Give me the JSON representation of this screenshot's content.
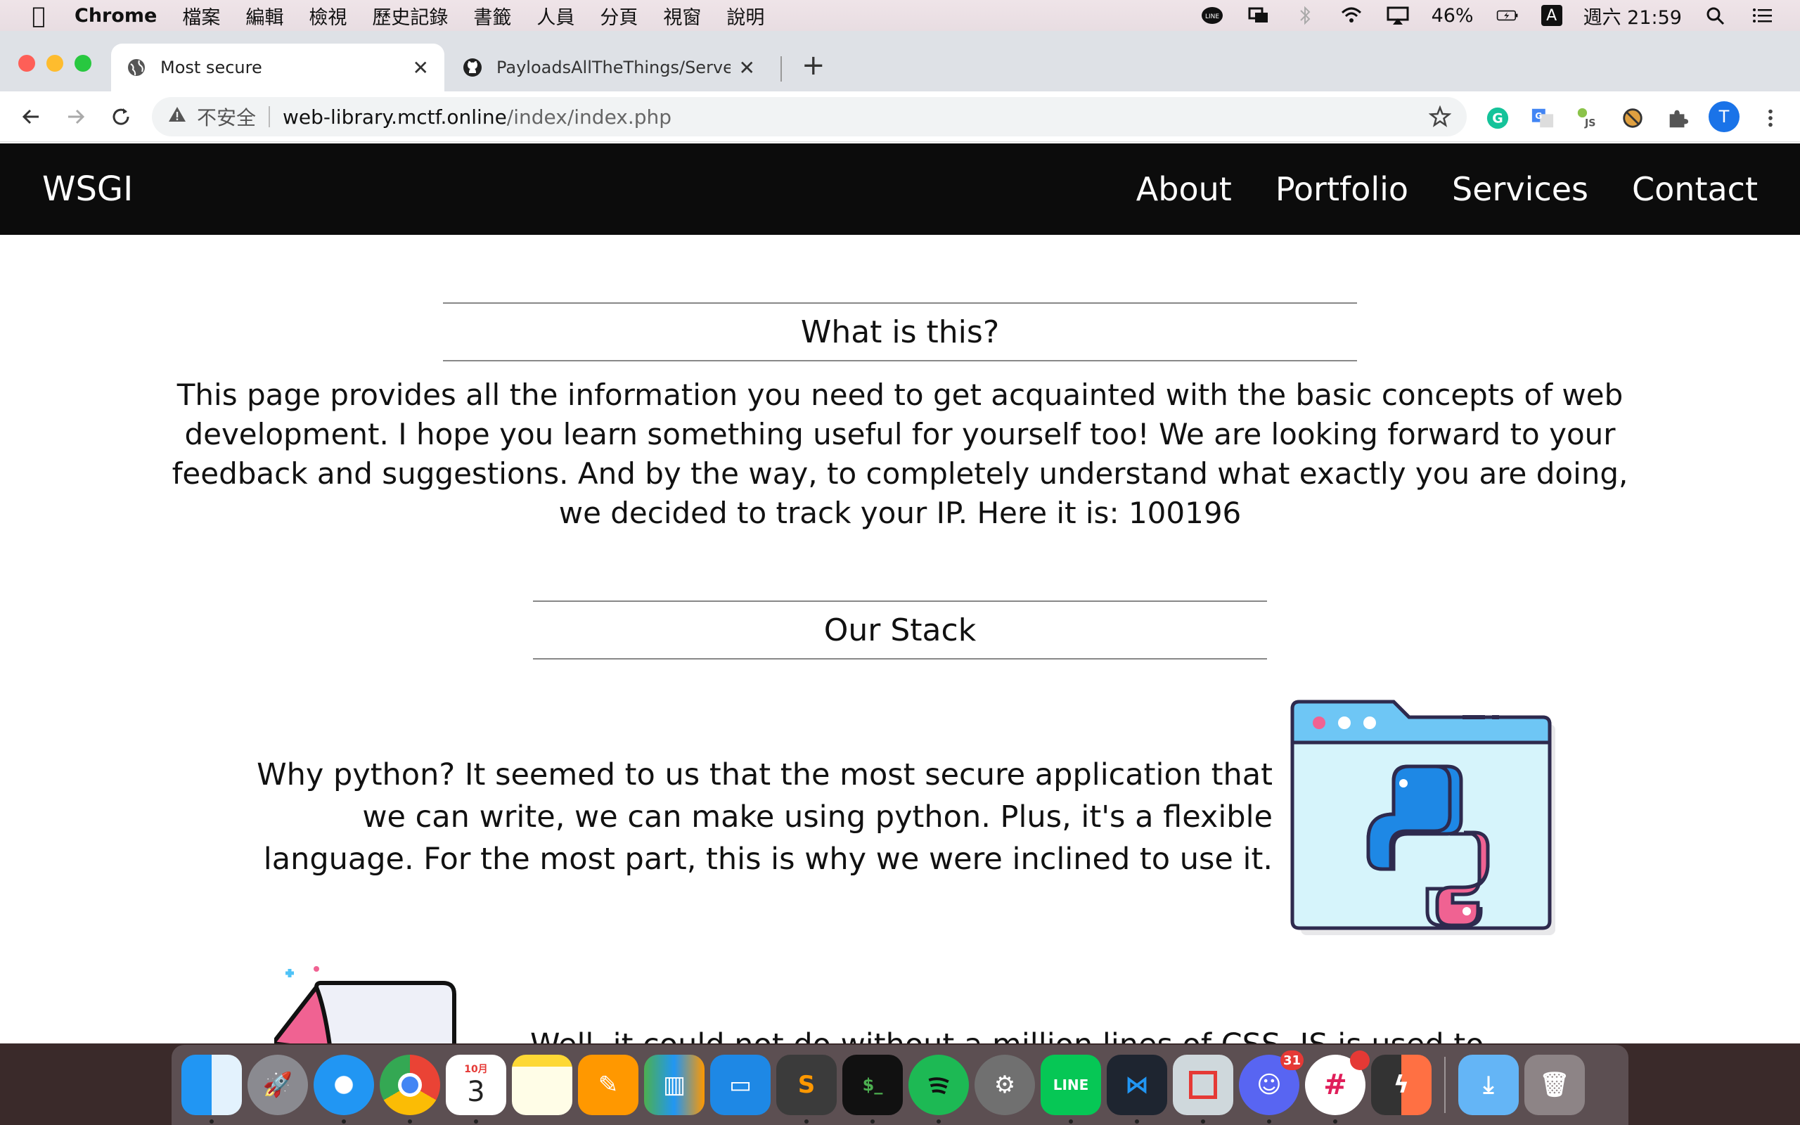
{
  "menubar": {
    "app_name": "Chrome",
    "menus": [
      "檔案",
      "編輯",
      "檢視",
      "歷史記錄",
      "書籤",
      "人員",
      "分頁",
      "視窗",
      "說明"
    ],
    "battery": "46%",
    "input_method": "A",
    "clock": "週六 21:59"
  },
  "browser": {
    "tabs": [
      {
        "title": "Most secure",
        "icon": "globe-icon"
      },
      {
        "title": "PayloadsAllTheThings/Server S",
        "icon": "github-icon"
      }
    ],
    "security_label": "不安全",
    "url_host": "web-library.mctf.online",
    "url_path": "/index/index.php",
    "profile_initial": "T"
  },
  "site": {
    "brand": "WSGI",
    "nav": [
      "About",
      "Portfolio",
      "Services",
      "Contact"
    ],
    "section1_title": "What is this?",
    "intro_lines": [
      "This page provides all the information you need to get acquainted with the basic concepts of web",
      "development. I hope you learn something useful for yourself too! We are looking forward to your",
      "feedback and suggestions. And by the way, to completely understand what exactly you are doing,",
      "we decided to track your IP. Here it is: 100196"
    ],
    "section2_title": "Our Stack",
    "python_lines": [
      "Why python? It seemed to us that the most secure application that",
      "we can write, we can make using python. Plus, it's a flexible",
      "language. For the most part, this is why we were inclined to use it."
    ],
    "css_line": "Well, it could not do without a million lines of CSS. JS is used to"
  },
  "dock": {
    "calendar_month": "10月",
    "calendar_day": "3",
    "discord_badge": "31",
    "line_label": "LINE",
    "terminal_prompt": "$_"
  },
  "colors": {
    "nav_bg": "#0c0c0c",
    "accent_blue": "#1a73e8",
    "python_blue": "#1e88e5",
    "python_pink": "#f06292",
    "folder_blue": "#6ec6f5"
  }
}
